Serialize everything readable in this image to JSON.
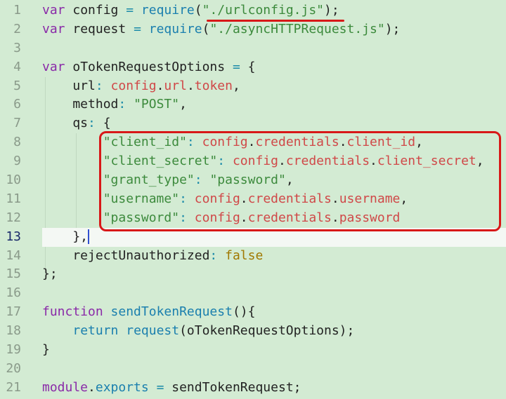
{
  "editor": {
    "current_line": 13,
    "lines": [
      {
        "n": "1",
        "tokens": [
          [
            "var",
            "kw"
          ],
          [
            " config ",
            "id"
          ],
          [
            "=",
            "op"
          ],
          [
            " ",
            "id"
          ],
          [
            "require",
            "fn"
          ],
          [
            "(",
            "id"
          ],
          [
            "\"./urlconfig.js\"",
            "str"
          ],
          [
            ");",
            "id"
          ]
        ]
      },
      {
        "n": "2",
        "tokens": [
          [
            "var",
            "kw"
          ],
          [
            " request ",
            "id"
          ],
          [
            "=",
            "op"
          ],
          [
            " ",
            "id"
          ],
          [
            "require",
            "fn"
          ],
          [
            "(",
            "id"
          ],
          [
            "\"./asyncHTTPRequest.js\"",
            "str"
          ],
          [
            ");",
            "id"
          ]
        ]
      },
      {
        "n": "3",
        "tokens": []
      },
      {
        "n": "4",
        "tokens": [
          [
            "var",
            "kw"
          ],
          [
            " oTokenRequestOptions ",
            "id"
          ],
          [
            "=",
            "op"
          ],
          [
            " {",
            "id"
          ]
        ]
      },
      {
        "n": "5",
        "tokens": [
          [
            "    url",
            "id"
          ],
          [
            ":",
            "op"
          ],
          [
            " ",
            "id"
          ],
          [
            "config",
            "prop"
          ],
          [
            ".",
            "id"
          ],
          [
            "url",
            "prop"
          ],
          [
            ".",
            "id"
          ],
          [
            "token",
            "prop"
          ],
          [
            ",",
            "id"
          ]
        ]
      },
      {
        "n": "6",
        "tokens": [
          [
            "    method",
            "id"
          ],
          [
            ":",
            "op"
          ],
          [
            " ",
            "id"
          ],
          [
            "\"POST\"",
            "str"
          ],
          [
            ",",
            "id"
          ]
        ]
      },
      {
        "n": "7",
        "tokens": [
          [
            "    qs",
            "id"
          ],
          [
            ":",
            "op"
          ],
          [
            " {",
            "id"
          ]
        ]
      },
      {
        "n": "8",
        "tokens": [
          [
            "        ",
            "id"
          ],
          [
            "\"client_id\"",
            "str"
          ],
          [
            ":",
            "op"
          ],
          [
            " ",
            "id"
          ],
          [
            "config",
            "prop"
          ],
          [
            ".",
            "id"
          ],
          [
            "credentials",
            "prop"
          ],
          [
            ".",
            "id"
          ],
          [
            "client_id",
            "prop"
          ],
          [
            ",",
            "id"
          ]
        ]
      },
      {
        "n": "9",
        "tokens": [
          [
            "        ",
            "id"
          ],
          [
            "\"client_secret\"",
            "str"
          ],
          [
            ":",
            "op"
          ],
          [
            " ",
            "id"
          ],
          [
            "config",
            "prop"
          ],
          [
            ".",
            "id"
          ],
          [
            "credentials",
            "prop"
          ],
          [
            ".",
            "id"
          ],
          [
            "client_secret",
            "prop"
          ],
          [
            ",",
            "id"
          ]
        ]
      },
      {
        "n": "10",
        "tokens": [
          [
            "        ",
            "id"
          ],
          [
            "\"grant_type\"",
            "str"
          ],
          [
            ":",
            "op"
          ],
          [
            " ",
            "id"
          ],
          [
            "\"password\"",
            "str"
          ],
          [
            ",",
            "id"
          ]
        ]
      },
      {
        "n": "11",
        "tokens": [
          [
            "        ",
            "id"
          ],
          [
            "\"username\"",
            "str"
          ],
          [
            ":",
            "op"
          ],
          [
            " ",
            "id"
          ],
          [
            "config",
            "prop"
          ],
          [
            ".",
            "id"
          ],
          [
            "credentials",
            "prop"
          ],
          [
            ".",
            "id"
          ],
          [
            "username",
            "prop"
          ],
          [
            ",",
            "id"
          ]
        ]
      },
      {
        "n": "12",
        "tokens": [
          [
            "        ",
            "id"
          ],
          [
            "\"password\"",
            "str"
          ],
          [
            ":",
            "op"
          ],
          [
            " ",
            "id"
          ],
          [
            "config",
            "prop"
          ],
          [
            ".",
            "id"
          ],
          [
            "credentials",
            "prop"
          ],
          [
            ".",
            "id"
          ],
          [
            "password",
            "prop"
          ]
        ]
      },
      {
        "n": "13",
        "tokens": [
          [
            "    },",
            "id"
          ]
        ]
      },
      {
        "n": "14",
        "tokens": [
          [
            "    rejectUnauthorized",
            "id"
          ],
          [
            ":",
            "op"
          ],
          [
            " ",
            "id"
          ],
          [
            "false",
            "bool"
          ]
        ]
      },
      {
        "n": "15",
        "tokens": [
          [
            "};",
            "id"
          ]
        ]
      },
      {
        "n": "16",
        "tokens": []
      },
      {
        "n": "17",
        "tokens": [
          [
            "function",
            "kw"
          ],
          [
            " ",
            "id"
          ],
          [
            "sendTokenRequest",
            "fn"
          ],
          [
            "(){",
            "id"
          ]
        ]
      },
      {
        "n": "18",
        "tokens": [
          [
            "    ",
            "id"
          ],
          [
            "return",
            "fn"
          ],
          [
            " ",
            "id"
          ],
          [
            "request",
            "fn"
          ],
          [
            "(oTokenRequestOptions);",
            "id"
          ]
        ]
      },
      {
        "n": "19",
        "tokens": [
          [
            "}",
            "id"
          ]
        ]
      },
      {
        "n": "20",
        "tokens": []
      },
      {
        "n": "21",
        "tokens": [
          [
            "module",
            "kw"
          ],
          [
            ".",
            "id"
          ],
          [
            "exports",
            "fn"
          ],
          [
            " ",
            "id"
          ],
          [
            "=",
            "op"
          ],
          [
            " sendTokenRequest;",
            "id"
          ]
        ]
      }
    ]
  },
  "annotations": {
    "highlight_color": "#d81818"
  }
}
